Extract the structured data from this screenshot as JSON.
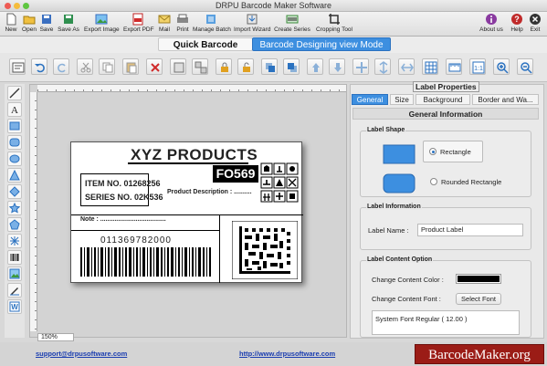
{
  "window": {
    "title": "DRPU Barcode Maker Software"
  },
  "toolbar": {
    "items": [
      {
        "label": "New",
        "icon": "new-document-icon"
      },
      {
        "label": "Open",
        "icon": "open-folder-icon"
      },
      {
        "label": "Save",
        "icon": "save-icon"
      },
      {
        "label": "Save As",
        "icon": "save-as-icon"
      },
      {
        "label": "Export Image",
        "icon": "export-image-icon"
      },
      {
        "label": "Export PDF",
        "icon": "export-pdf-icon"
      },
      {
        "label": "Mail",
        "icon": "mail-icon"
      },
      {
        "label": "Print",
        "icon": "print-icon"
      },
      {
        "label": "Manage Batch",
        "icon": "manage-batch-icon"
      },
      {
        "label": "Import Wizard",
        "icon": "import-wizard-icon"
      },
      {
        "label": "Create Series",
        "icon": "create-series-icon"
      },
      {
        "label": "Cropping Tool",
        "icon": "crop-icon"
      }
    ],
    "right": [
      {
        "label": "About us",
        "icon": "info-icon"
      },
      {
        "label": "Help",
        "icon": "help-icon"
      },
      {
        "label": "Exit",
        "icon": "exit-icon"
      }
    ]
  },
  "modes": {
    "quick": "Quick Barcode Mode",
    "design": "Barcode Designing view Mode"
  },
  "canvas": {
    "zoom": "150%",
    "label": {
      "title": "XYZ PRODUCTS",
      "item_no": "ITEM NO. 01268256",
      "series_no": "SERIES NO. 02K536",
      "code": "FO569",
      "product_description": "Product Description : ..........",
      "note": "Note : .....................................",
      "barcode_number": "011369782000"
    }
  },
  "panel": {
    "title": "Label Properties",
    "tabs": [
      "General",
      "Size",
      "Background",
      "Border and Wa..."
    ],
    "section_header": "General Information",
    "label_shape": {
      "title": "Label Shape",
      "rectangle": "Rectangle",
      "rounded": "Rounded Rectangle",
      "selected": "Rectangle"
    },
    "label_information": {
      "title": "Label Information",
      "name_label": "Label Name :",
      "name_value": "Product Label"
    },
    "content_option": {
      "title": "Label Content Option",
      "color_label": "Change Content Color :",
      "font_label": "Change Content Font :",
      "font_button": "Select Font",
      "font_value": "System Font Regular ( 12.00 )",
      "content_color": "#000000"
    }
  },
  "footer": {
    "email": "support@drpusoftware.com",
    "website": "http://www.drpusoftware.com",
    "brand": "BarcodeMaker.org"
  },
  "colors": {
    "accent": "#3d8fe0",
    "brand": "#9b1c16"
  }
}
